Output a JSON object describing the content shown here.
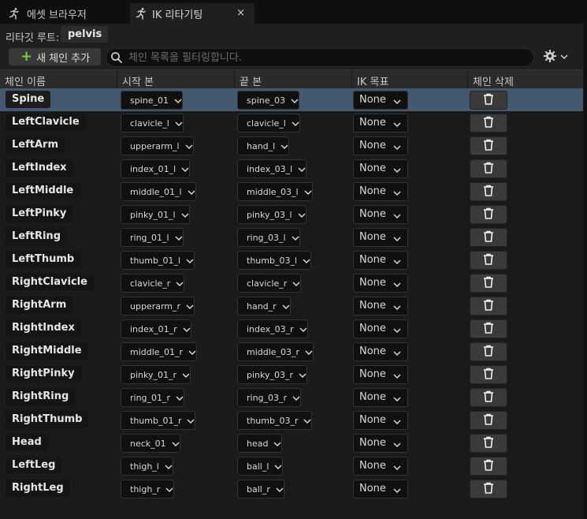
{
  "tabs": [
    {
      "label": "에셋 브라우저",
      "icon": "figure-icon",
      "active": false
    },
    {
      "label": "IK 리타기팅",
      "icon": "figure-icon",
      "active": true,
      "close": "×"
    }
  ],
  "root": {
    "label": "리타깃 루트:",
    "value": "pelvis"
  },
  "toolbar": {
    "add_label": "새 체인 추가",
    "search_placeholder": "체인 목록을 필터링합니다.",
    "settings_icon": "gear-icon"
  },
  "columns": [
    "체인 이름",
    "시작 본",
    "끝 본",
    "IK 목표",
    "체인 삭제"
  ],
  "rows": [
    {
      "name": "Spine",
      "start": "spine_01",
      "end": "spine_03",
      "ik": "None",
      "selected": true
    },
    {
      "name": "LeftClavicle",
      "start": "clavicle_l",
      "end": "clavicle_l",
      "ik": "None"
    },
    {
      "name": "LeftArm",
      "start": "upperarm_l",
      "end": "hand_l",
      "ik": "None"
    },
    {
      "name": "LeftIndex",
      "start": "index_01_l",
      "end": "index_03_l",
      "ik": "None"
    },
    {
      "name": "LeftMiddle",
      "start": "middle_01_l",
      "end": "middle_03_l",
      "ik": "None"
    },
    {
      "name": "LeftPinky",
      "start": "pinky_01_l",
      "end": "pinky_03_l",
      "ik": "None"
    },
    {
      "name": "LeftRing",
      "start": "ring_01_l",
      "end": "ring_03_l",
      "ik": "None"
    },
    {
      "name": "LeftThumb",
      "start": "thumb_01_l",
      "end": "thumb_03_l",
      "ik": "None"
    },
    {
      "name": "RightClavicle",
      "start": "clavicle_r",
      "end": "clavicle_r",
      "ik": "None"
    },
    {
      "name": "RightArm",
      "start": "upperarm_r",
      "end": "hand_r",
      "ik": "None"
    },
    {
      "name": "RightIndex",
      "start": "index_01_r",
      "end": "index_03_r",
      "ik": "None"
    },
    {
      "name": "RightMiddle",
      "start": "middle_01_r",
      "end": "middle_03_r",
      "ik": "None"
    },
    {
      "name": "RightPinky",
      "start": "pinky_01_r",
      "end": "pinky_03_r",
      "ik": "None"
    },
    {
      "name": "RightRing",
      "start": "ring_01_r",
      "end": "ring_03_r",
      "ik": "None"
    },
    {
      "name": "RightThumb",
      "start": "thumb_01_r",
      "end": "thumb_03_r",
      "ik": "None"
    },
    {
      "name": "Head",
      "start": "neck_01",
      "end": "head",
      "ik": "None"
    },
    {
      "name": "LeftLeg",
      "start": "thigh_l",
      "end": "ball_l",
      "ik": "None"
    },
    {
      "name": "RightLeg",
      "start": "thigh_r",
      "end": "ball_r",
      "ik": "None"
    }
  ],
  "colors": {
    "background": "#1a1a1a",
    "panel": "#1f1f1f",
    "header": "#2b2b2b",
    "selected_row": "#445870",
    "add_plus": "#7cc64a"
  }
}
